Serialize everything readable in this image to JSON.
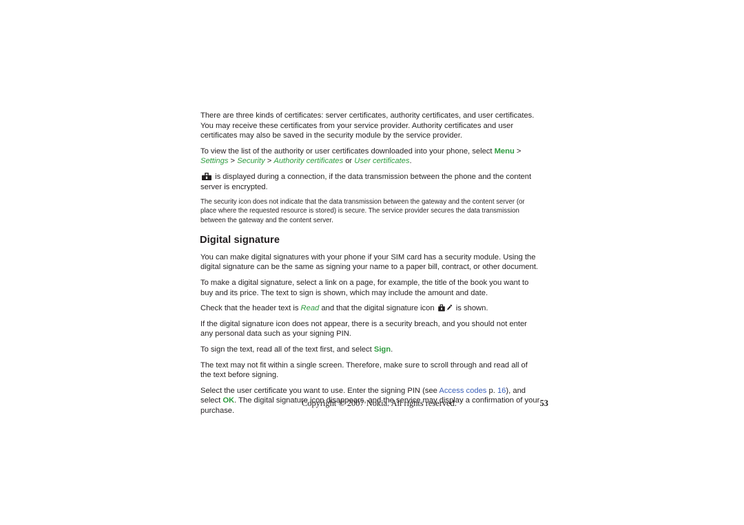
{
  "document": {
    "page_number": "53",
    "footer_copyright": "Copyright © 2007 Nokia. All rights reserved."
  },
  "colors": {
    "ui_green": "#2e9b3f",
    "link_blue": "#3a5fb8",
    "body_text": "#231f20",
    "page_background": "#ffffff"
  },
  "content": {
    "para_certificates_kinds": "There are three kinds of certificates: server certificates, authority certificates, and user certificates. You may receive these certificates from your service provider. Authority certificates and user certificates may also be saved in the security module by the service provider.",
    "para_view_list": {
      "lead": "To view the list of the authority or user certificates downloaded into your phone, select ",
      "menu": "Menu",
      "sep1": " > ",
      "settings": "Settings",
      "sep2": " > ",
      "security": "Security",
      "sep3": " > ",
      "authority_certificates": "Authority certificates",
      "conjunction": " or ",
      "user_certificates": "User certificates",
      "period": "."
    },
    "para_security_icon": {
      "icon_name": "security-lock-icon",
      "text": " is displayed during a connection, if the data transmission between the phone and the content server is encrypted."
    },
    "note_security_icon": "The security icon does not indicate that the data transmission between the gateway and the content server (or place where the requested resource is stored) is secure. The service provider secures the data transmission between the gateway and the content server.",
    "heading_digital_signature": "Digital signature",
    "para_make_signatures": "You can make digital signatures with your phone if your SIM card has a security module. Using the digital signature can be the same as signing your name to a paper bill, contract, or other document.",
    "para_make_a_signature": "To make a digital signature, select a link on a page, for example, the title of the book you want to buy and its price. The text to sign is shown, which may include the amount and date.",
    "para_check_header": {
      "lead": "Check that the header text is ",
      "read": "Read",
      "mid": " and that the digital signature icon ",
      "icon_name": "digital-signature-icon",
      "tail": " is shown."
    },
    "para_icon_missing": "If the digital signature icon does not appear, there is a security breach, and you should not enter any personal data such as your signing PIN.",
    "para_sign_text": {
      "lead": "To sign the text, read all of the text first, and select ",
      "sign": "Sign",
      "period": "."
    },
    "para_scroll": "The text may not fit within a single screen. Therefore, make sure to scroll through and read all of the text before signing.",
    "para_select_certificate": {
      "lead": "Select the user certificate you want to use. Enter the signing PIN (see ",
      "access_codes": "Access codes",
      "page_label": " p. ",
      "page_ref": "16",
      "mid": "), and select ",
      "ok": "OK",
      "tail": ". The digital signature icon disappears, and the service may display a confirmation of your purchase."
    }
  }
}
